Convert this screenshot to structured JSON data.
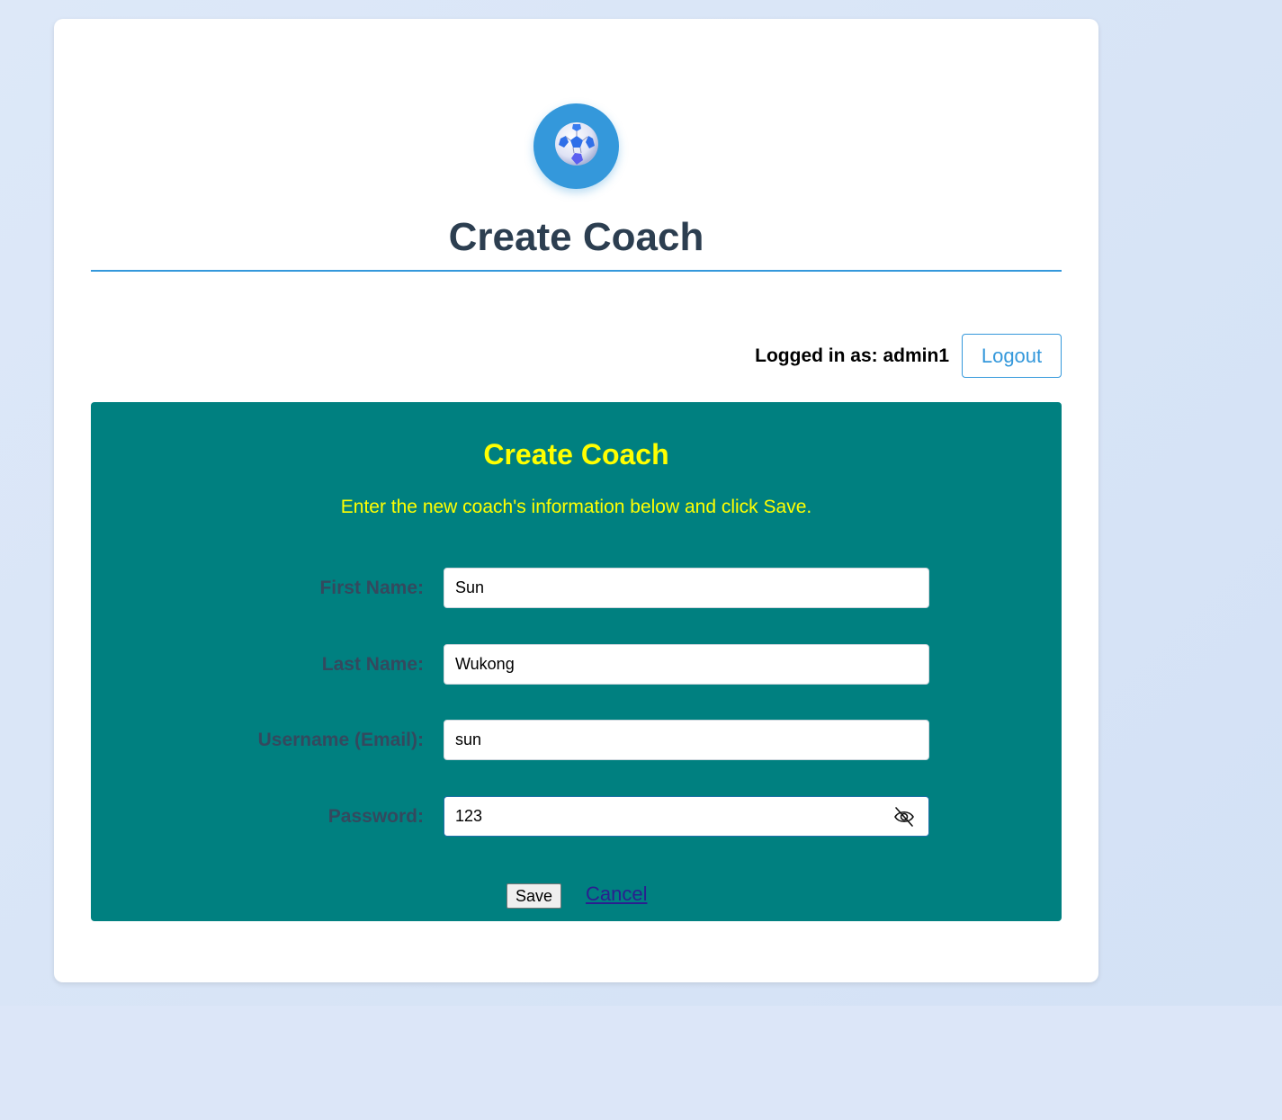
{
  "page": {
    "title": "Create Coach",
    "logo_icon": "soccer-ball-icon"
  },
  "session": {
    "logged_in_text": "Logged in as: admin1",
    "logout_label": "Logout"
  },
  "form": {
    "title": "Create Coach",
    "description": "Enter the new coach's information below and click Save.",
    "fields": [
      {
        "label": "First Name:",
        "value": "Sun"
      },
      {
        "label": "Last Name:",
        "value": "Wukong"
      },
      {
        "label": "Username (Email):",
        "value": "sun"
      },
      {
        "label": "Password:",
        "value": "123",
        "toggle_icon": "eye-slash-icon"
      }
    ],
    "save_label": "Save",
    "cancel_label": "Cancel"
  },
  "colors": {
    "accent": "#3498db",
    "panel_bg": "#008080",
    "panel_text": "#ffff00",
    "title_text": "#2c3e50"
  }
}
